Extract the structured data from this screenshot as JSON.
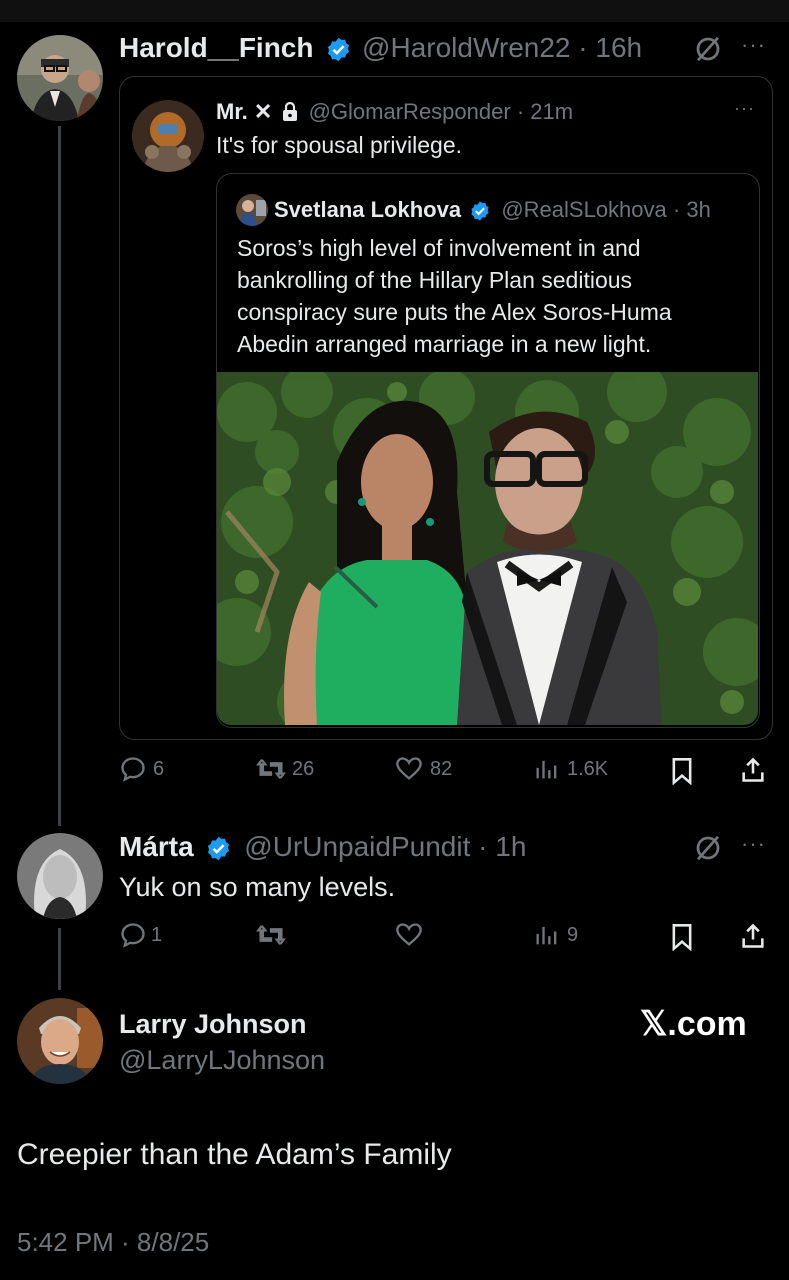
{
  "tweet1": {
    "display_name": "Harold__Finch",
    "handle": "@HaroldWren22",
    "time": "· 16h",
    "actions": {
      "replies": "6",
      "reposts": "26",
      "likes": "82",
      "views": "1.6K"
    }
  },
  "quote1": {
    "display_name": "Mr. ✕",
    "handle": "@GlomarResponder",
    "time": "· 21m",
    "text": "It's for spousal privilege."
  },
  "quote2": {
    "display_name": "Svetlana Lokhova",
    "handle": "@RealSLokhova",
    "time": "· 3h",
    "text": "Soros’s high level of involvement in and bankrolling of the Hillary Plan seditious conspiracy sure puts the Alex Soros-Huma Abedin arranged marriage in a new light."
  },
  "tweet2": {
    "display_name": "Márta",
    "handle": "@UrUnpaidPundit",
    "time": "· 1h",
    "text": "Yuk on so many levels.",
    "actions": {
      "replies": "1",
      "views": "9"
    }
  },
  "main": {
    "display_name": "Larry Johnson",
    "handle": "@LarryLJohnson",
    "brand": "𝕏.com",
    "text": "Creepier than the Adam’s Family",
    "timestamp": "5:42 PM · 8/8/25"
  },
  "colors": {
    "verified": "#1d9bf0",
    "background": "#000000",
    "muted": "#71767b",
    "photo_dress": "#1fae5f",
    "photo_foliage": "#2f4d22"
  }
}
